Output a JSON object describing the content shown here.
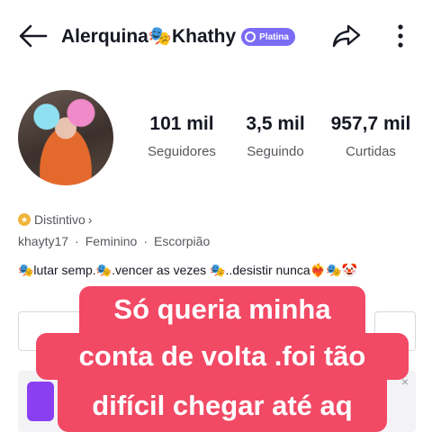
{
  "header": {
    "title": "Alerquina🎭Khathy",
    "badge_label": "Platina",
    "icons": [
      "arrow-left-icon",
      "share-icon",
      "more-vertical-icon"
    ]
  },
  "stats": [
    {
      "value": "101 mil",
      "label": "Seguidores"
    },
    {
      "value": "3,5 mil",
      "label": "Seguindo"
    },
    {
      "value": "957,7 mil",
      "label": "Curtidas"
    }
  ],
  "distintivo": {
    "label": "Distintivo",
    "chevron": "›"
  },
  "meta": {
    "username": "khayty17",
    "gender": "Feminino",
    "sign": "Escorpião",
    "separator": "·"
  },
  "bio": "🎭lutar semp.🎭.vencer as vezes 🎭..desistir nunca❤️‍🔥🎭🤡",
  "caption": {
    "line1": "Só queria minha",
    "line2": "conta de volta .foi tão",
    "line3": "difícil chegar até aq"
  },
  "promo": {
    "close_label": "×"
  },
  "colors": {
    "badge": "#7b6cf5",
    "caption_bg": "#f24965",
    "promo_accent": "#8a3ff0"
  }
}
